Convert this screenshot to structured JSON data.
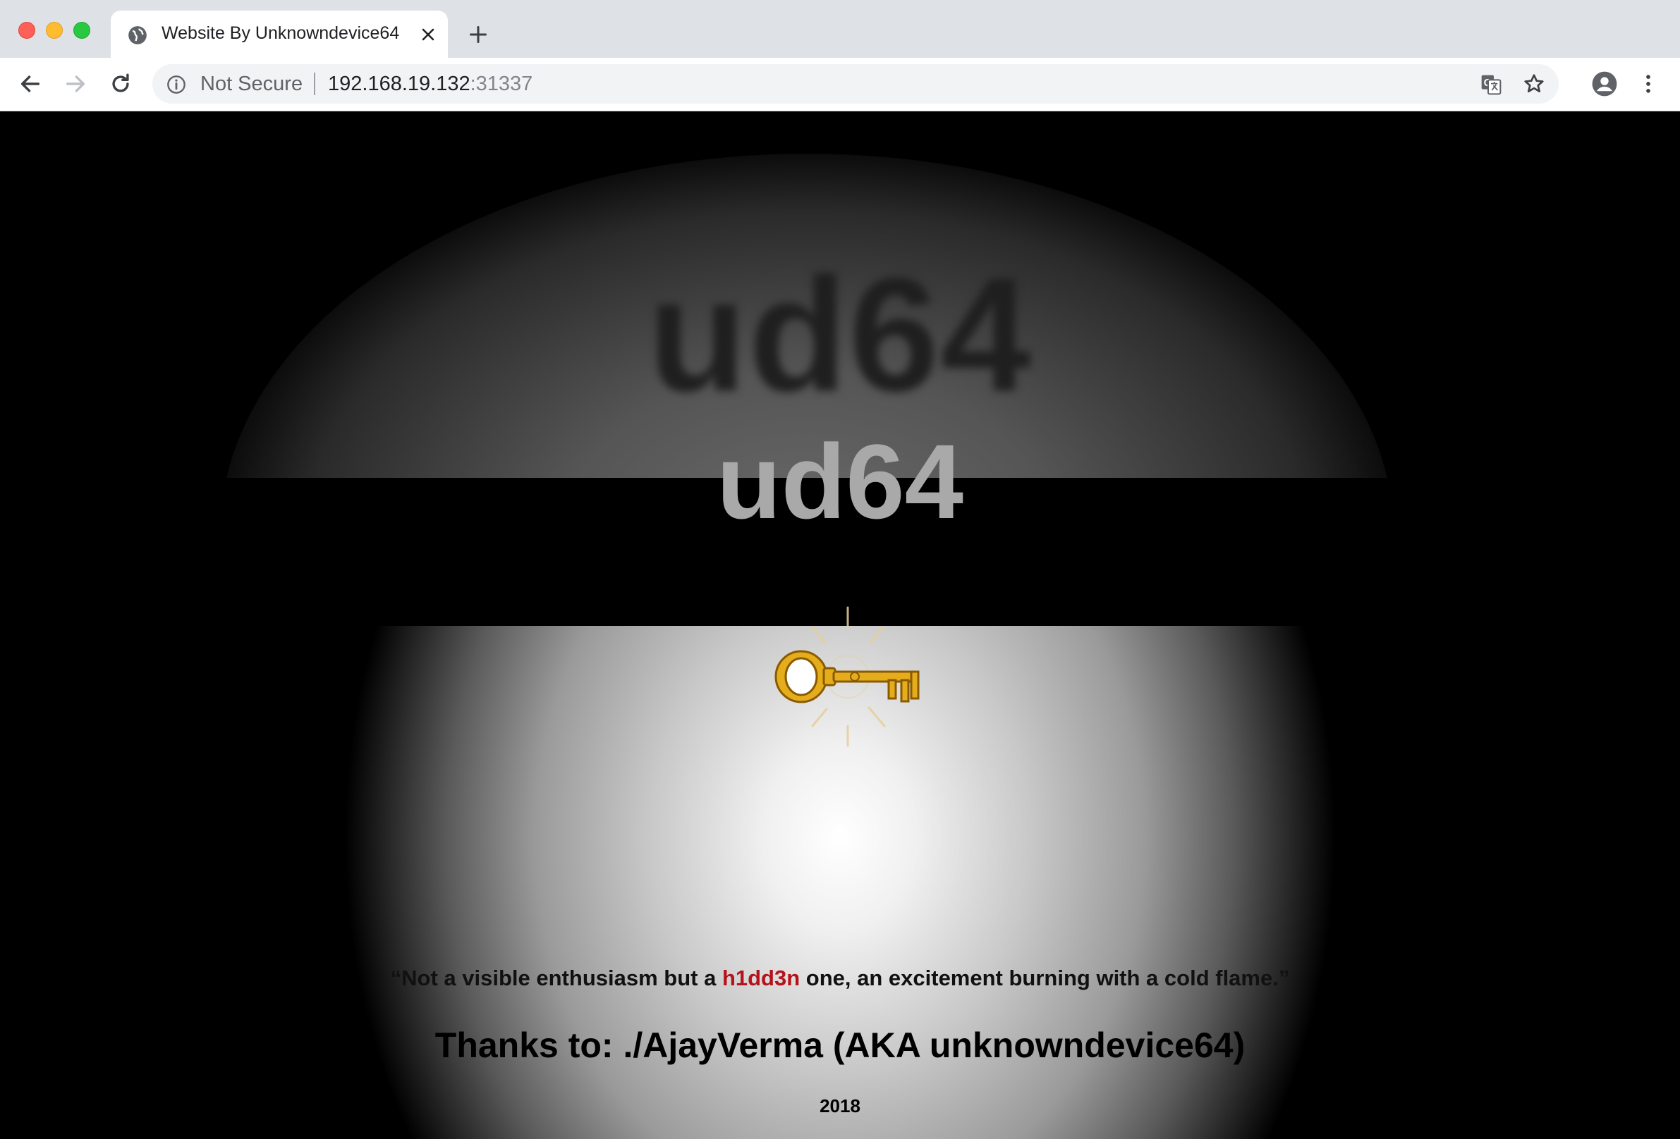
{
  "window": {
    "traffic_lights": [
      "close",
      "minimize",
      "zoom"
    ]
  },
  "tab": {
    "title": "Website By Unknowndevice64",
    "favicon": "globe-icon"
  },
  "toolbar": {
    "security_label": "Not Secure",
    "url_host": "192.168.19.132",
    "url_port": ":31337"
  },
  "page": {
    "blurred_logo": "ud64",
    "logo": "ud64",
    "quote_before": "“Not a visible enthusiasm but a ",
    "quote_hidden": "h1dd3n",
    "quote_after": " one, an excitement burning with a cold flame.”",
    "thanks": "Thanks to: ./AjayVerma (AKA unknowndevice64)",
    "year": "2018"
  },
  "colors": {
    "hidden_word": "#b5121b",
    "key_gold": "#e5ad1c",
    "logo_gray": "#a9a9a9"
  }
}
